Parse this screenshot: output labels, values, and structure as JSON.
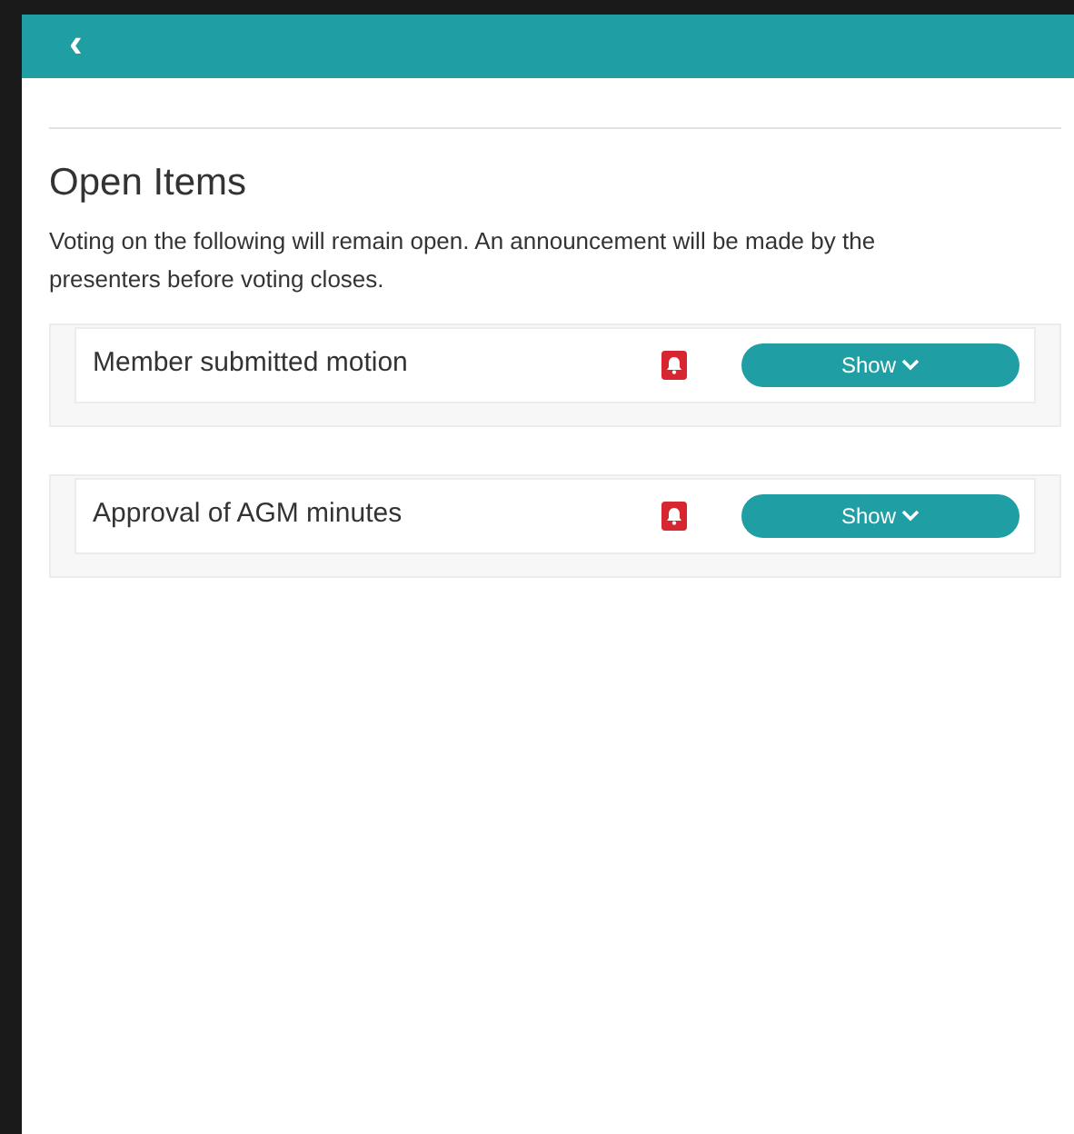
{
  "header": {
    "back": "‹"
  },
  "title": "Open Items",
  "description": "Voting on the following will remain open. An announcement will be made by the presenters before voting closes.",
  "items": [
    {
      "name": "Member submitted motion",
      "button": "Show"
    },
    {
      "name": "Approval of AGM minutes",
      "button": "Show"
    }
  ]
}
